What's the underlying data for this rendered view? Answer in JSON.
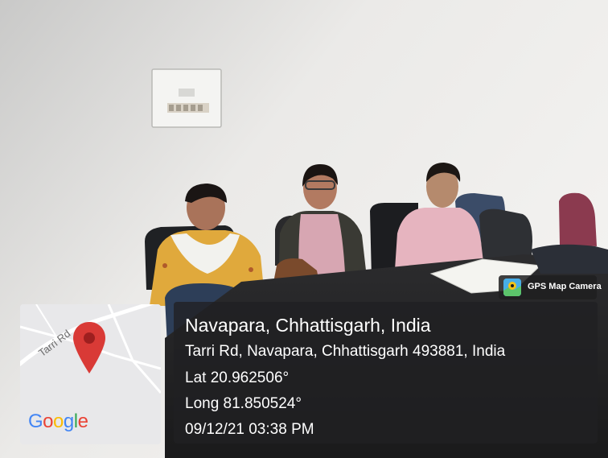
{
  "photo": {
    "description_icons": [
      "wall-switch-board",
      "people-seated",
      "office-chairs",
      "table-with-papers",
      "bag"
    ]
  },
  "badge": {
    "app_name": "GPS Map Camera",
    "icon": "gps-map-camera-icon"
  },
  "map": {
    "road_label": "Tarri Rd",
    "logo": "Google",
    "pin_color": "#d93a36"
  },
  "location": {
    "place": "Navapara, Chhattisgarh, India",
    "address": "Tarri Rd, Navapara, Chhattisgarh 493881, India",
    "latitude": "Lat 20.962506°",
    "longitude": "Long 81.850524°",
    "datetime": "09/12/21 03:38 PM"
  }
}
